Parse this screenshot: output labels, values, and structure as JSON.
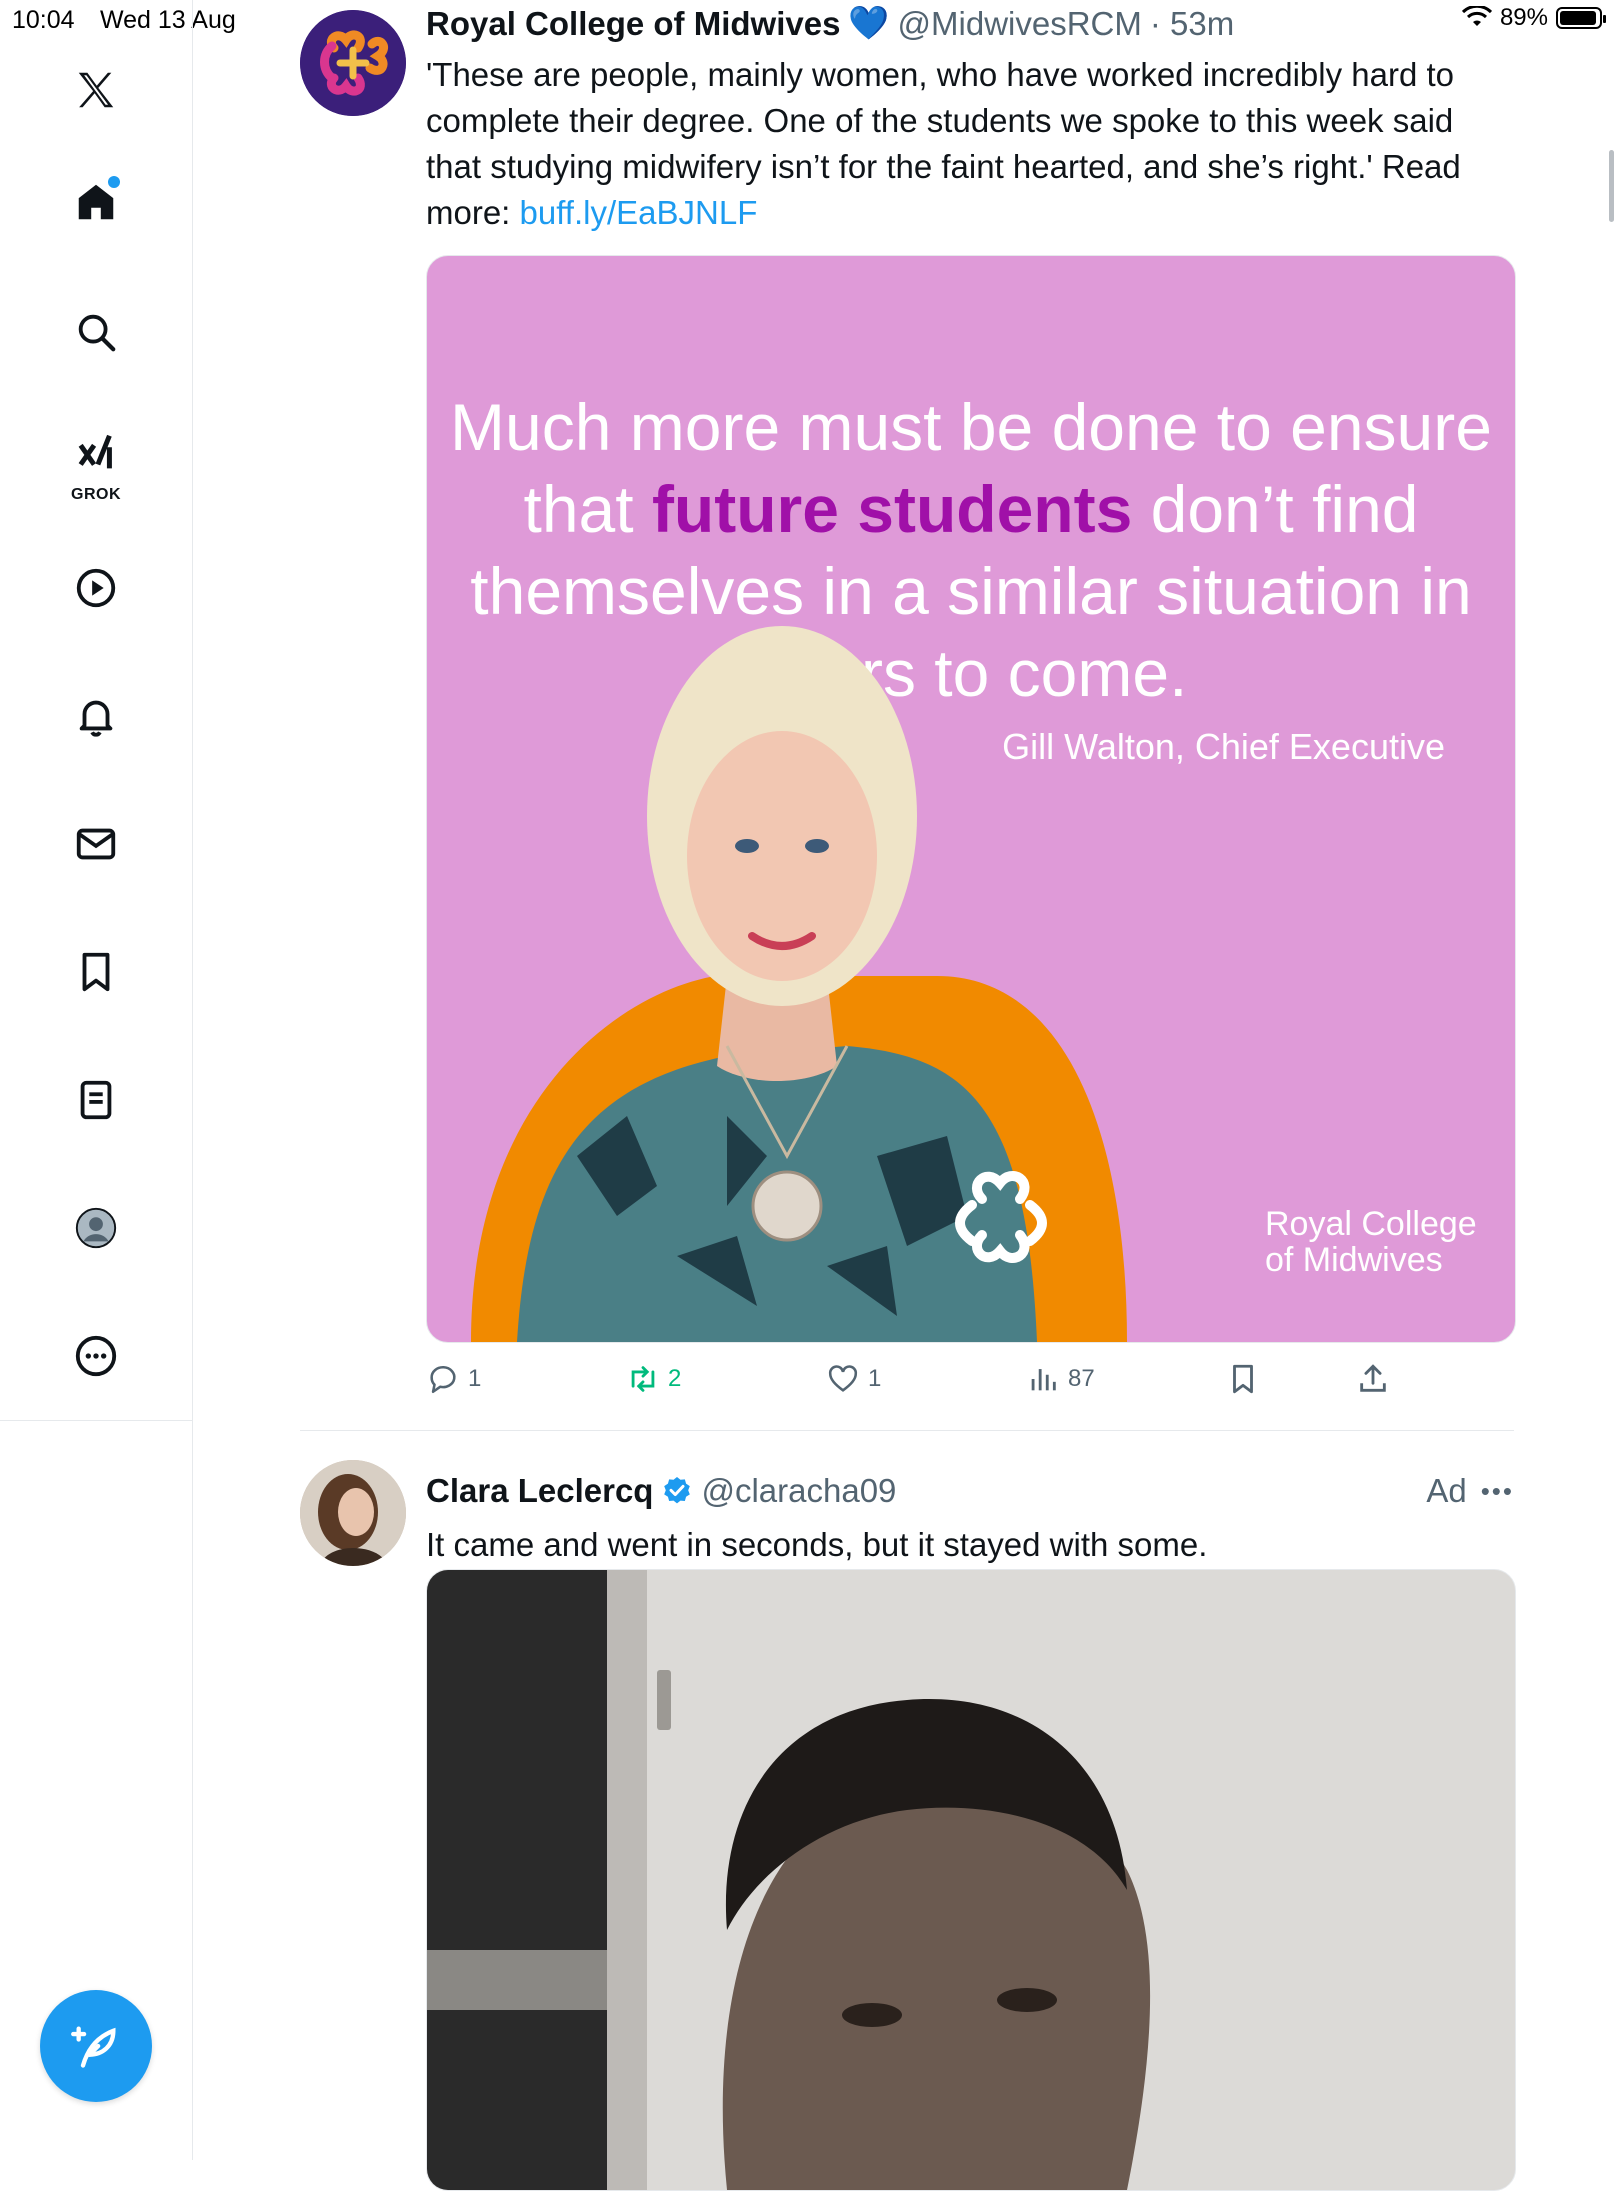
{
  "status_bar": {
    "time": "10:04",
    "date": "Wed 13 Aug",
    "battery": "89%"
  },
  "sidebar": {
    "items": [
      {
        "name": "home",
        "icon": "home-icon"
      },
      {
        "name": "explore",
        "icon": "search-icon"
      },
      {
        "name": "grok",
        "icon": "grok-icon",
        "label": "GROK"
      },
      {
        "name": "videos",
        "icon": "play-icon"
      },
      {
        "name": "notifications",
        "icon": "bell-icon"
      },
      {
        "name": "messages",
        "icon": "mail-icon"
      },
      {
        "name": "bookmarks",
        "icon": "bookmark-icon"
      },
      {
        "name": "lists",
        "icon": "list-icon"
      },
      {
        "name": "profile",
        "icon": "profile-icon"
      },
      {
        "name": "more",
        "icon": "more-icon"
      }
    ],
    "accent": "#1d9bf0"
  },
  "tweets": [
    {
      "author": "Royal College of Midwives",
      "emoji": "💙",
      "handle": "@MidwivesRCM",
      "time": "· 53m",
      "text": "'These are people, mainly women, who have worked incredibly hard to complete their degree. One of the students we spoke to this week said that studying midwifery isn’t for the faint hearted, and she’s right.' Read more: ",
      "link": "buff.ly/EaBJNLF",
      "media": {
        "quote_pre": "Much more must be done to ensure that ",
        "quote_highlight": "future students",
        "quote_post": " don’t find themselves in a similar situation in years to come.",
        "attribution": "Gill Walton, Chief Executive",
        "logo_line1": "Royal College",
        "logo_line2": "of Midwives",
        "bg_color": "#df9ad8",
        "highlight_color": "#a010a8",
        "accent_color": "#f18a00"
      },
      "stats": {
        "replies": "1",
        "reposts": "2",
        "likes": "1",
        "views": "87"
      }
    },
    {
      "author": "Clara Leclercq",
      "handle": "@claracha09",
      "ad": "Ad",
      "text": "It came and went in seconds, but it stayed with some."
    }
  ]
}
